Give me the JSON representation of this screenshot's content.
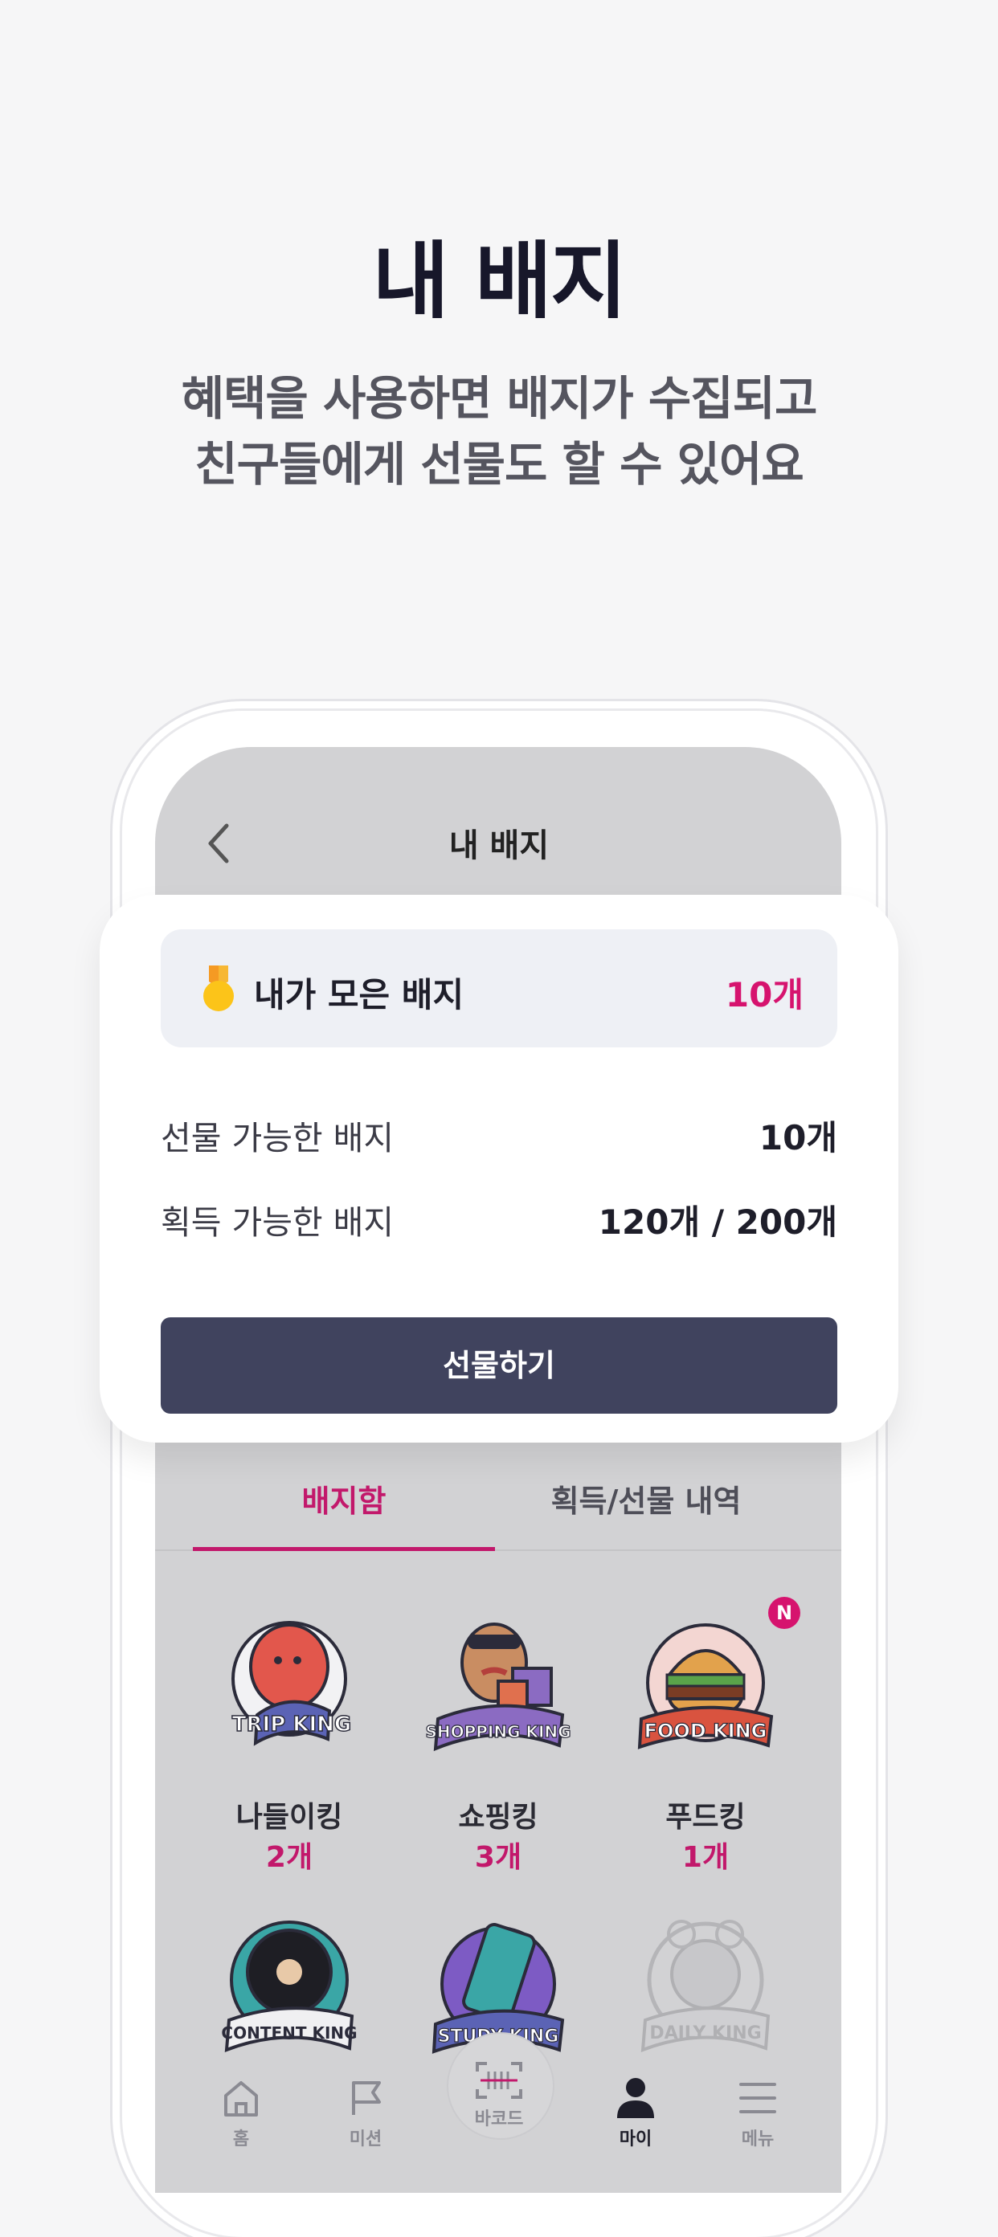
{
  "hero": {
    "title": "내 배지",
    "subtitle_line1": "혜택을 사용하면 배지가 수집되고",
    "subtitle_line2": "친구들에게 선물도 할 수 있어요"
  },
  "screen": {
    "title": "내 배지"
  },
  "summary": {
    "label": "내가 모은 배지",
    "count": "10개",
    "giftable_label": "선물 가능한 배지",
    "giftable_value": "10개",
    "obtainable_label": "획득 가능한 배지",
    "obtainable_value": "120개 / 200개",
    "gift_button": "선물하기"
  },
  "tabs": [
    {
      "label": "배지함",
      "active": true
    },
    {
      "label": "획득/선물 내역",
      "active": false
    }
  ],
  "badges": [
    {
      "name": "나들이킹",
      "count": "2개",
      "art_text": "TRIP KING",
      "color": "#5b63b5"
    },
    {
      "name": "쇼핑킹",
      "count": "3개",
      "art_text": "SHOPPING KING",
      "color": "#8b6bc2"
    },
    {
      "name": "푸드킹",
      "count": "1개",
      "art_text": "FOOD KING",
      "color": "#d9533f",
      "new_badge": "N"
    },
    {
      "art_text": "CONTENT KING",
      "color": "#3aa6a6"
    },
    {
      "art_text": "STUDY KING",
      "color": "#7d5bc4"
    },
    {
      "art_text": "DAILY KING",
      "color": "#b5b5b8"
    }
  ],
  "nav": [
    {
      "label": "홈",
      "icon": "home-icon"
    },
    {
      "label": "미션",
      "icon": "flag-icon"
    },
    {
      "label": "바코드",
      "icon": "barcode-icon"
    },
    {
      "label": "마이",
      "icon": "person-icon",
      "active": true
    },
    {
      "label": "메뉴",
      "icon": "menu-icon"
    }
  ],
  "colors": {
    "accent": "#c2186b",
    "button": "#40435e",
    "background": "#f6f6f7"
  }
}
